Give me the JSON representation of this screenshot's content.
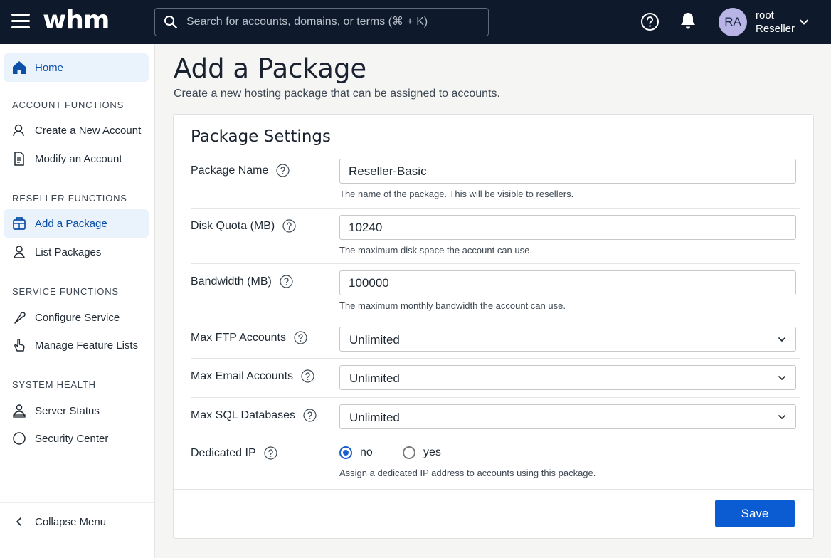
{
  "app": {
    "logo_text": "whm"
  },
  "header": {
    "search_placeholder": "Search for accounts, domains, or terms (⌘ + K)",
    "user_initials": "RA",
    "user_name": "root",
    "user_role": "Reseller"
  },
  "sidebar": {
    "home": "Home",
    "sections": [
      {
        "title": "ACCOUNT FUNCTIONS",
        "items": [
          "Create a New Account",
          "Modify an Account"
        ]
      },
      {
        "title": "RESELLER FUNCTIONS",
        "items": [
          "Add a Package",
          "List Packages"
        ]
      },
      {
        "title": "SERVICE FUNCTIONS",
        "items": [
          "Configure Service",
          "Manage Feature Lists"
        ]
      },
      {
        "title": "SYSTEM HEALTH",
        "items": [
          "Server Status",
          "Security Center"
        ]
      }
    ],
    "active_item": "Add a Package",
    "collapse": "Collapse Menu"
  },
  "main": {
    "title": "Add a Package",
    "subtitle": "Create a new hosting package that can be assigned to accounts."
  },
  "form": {
    "section_title": "Package Settings",
    "package_name": {
      "label": "Package Name",
      "value": "Reseller-Basic",
      "hint": "The name of the package. This will be visible to resellers."
    },
    "disk_quota": {
      "label": "Disk Quota (MB)",
      "value": "10240",
      "hint": "The maximum disk space the account can use."
    },
    "bandwidth": {
      "label": "Bandwidth (MB)",
      "value": "100000",
      "hint": "The maximum monthly bandwidth the account can use."
    },
    "max_ftp": {
      "label": "Max FTP Accounts",
      "value": "Unlimited"
    },
    "max_email": {
      "label": "Max Email Accounts",
      "value": "Unlimited"
    },
    "max_sql": {
      "label": "Max SQL Databases",
      "value": "Unlimited"
    },
    "dedicated_ip": {
      "label": "Dedicated IP",
      "options": [
        "no",
        "yes"
      ],
      "selected": "no",
      "hint": "Assign a dedicated IP address to accounts using this package."
    },
    "save_label": "Save"
  },
  "colors": {
    "topbar": "#0e1a2b",
    "accent": "#0b5bd3",
    "active_bg": "#eaf2fb",
    "avatar": "#b8b4e6"
  }
}
